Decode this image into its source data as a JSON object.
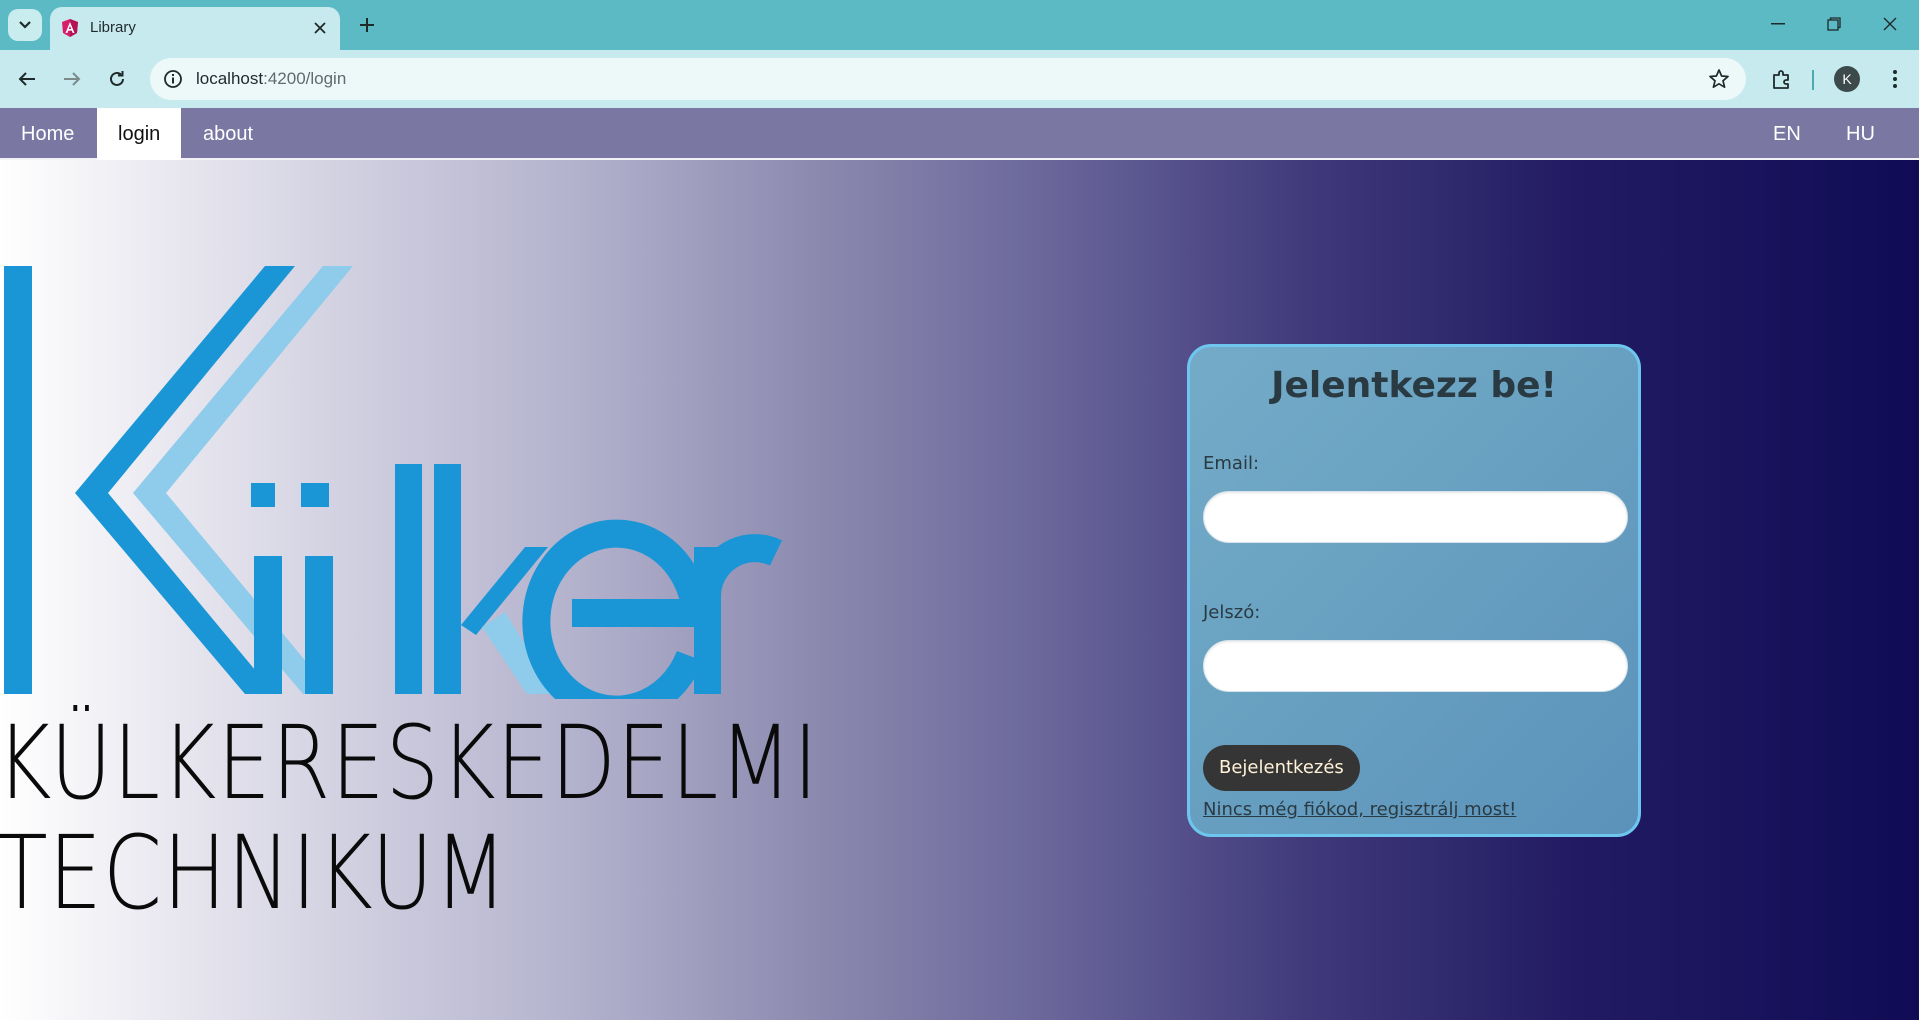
{
  "browser": {
    "tab_title": "Library",
    "url_host": "localhost",
    "url_path": ":4200/login",
    "profile_initial": "K"
  },
  "nav": {
    "left": [
      "Home",
      "login",
      "about"
    ],
    "active": "login",
    "right": [
      "EN",
      "HU"
    ]
  },
  "logo": {
    "line1": "KÜLKERESKEDELMI",
    "line2": "TECHNIKUM",
    "colors": {
      "dark_blue": "#1a96d6",
      "light_blue": "#8fcbea"
    }
  },
  "login": {
    "title": "Jelentkezz be!",
    "email_label": "Email:",
    "email_value": "",
    "password_label": "Jelszó:",
    "password_value": "",
    "submit_label": "Bejelentkezés",
    "register_link": "Nincs még fiókod, regisztrálj most!"
  },
  "colors": {
    "chrome_tabbar": "#5bbac4",
    "chrome_toolbar": "#c7eaee",
    "nav_bg": "#7a78a2",
    "card_border": "#6ec6ee",
    "button_bg": "#353535"
  }
}
